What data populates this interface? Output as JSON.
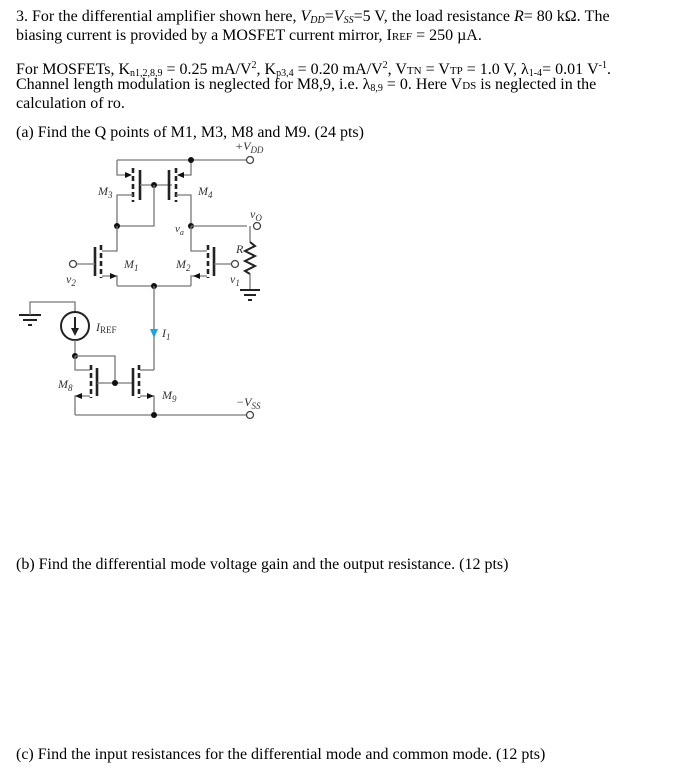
{
  "problem": {
    "number": "3.",
    "intro_1a": "For the differential amplifier shown here, ",
    "vdd_sym": "V",
    "vdd_sub": "DD",
    "eq1": "=",
    "vss_sym": "V",
    "vss_sub": "SS",
    "intro_1b": "=5 V, the load resistance ",
    "r_sym": "R",
    "intro_1c": "= 80 kΩ.  The",
    "intro_2a": "biasing current is provided by a MOSFET current mirror, I",
    "iref_sub": "REF",
    "intro_2b": " = 250 µA.",
    "params_1a": "For MOSFETs, K",
    "kn_sub": "n1,2,8,9",
    "params_1b": " = 0.25 mA/V",
    "sq": "2",
    "params_1c": ", K",
    "kp_sub": "p3,4",
    "params_1d": " = 0.20 mA/V",
    "params_1e": ", V",
    "vtn_sub": "TN",
    "params_1f": " = V",
    "vtp_sub": "TP",
    "params_1g": " = 1.0 V, λ",
    "lambda_sub": "1-4",
    "params_1h": "= 0.01 V",
    "inv": "-1",
    "params_1i": ".",
    "params_2a": "Channel length modulation is neglected for M8,9, i.e. λ",
    "lambda89_sub": "8,9",
    "params_2b": " = 0. Here V",
    "vds_sub": "DS",
    "params_2c": " is neglected in the",
    "params_3": "calculation of ro.",
    "part_a": "(a) Find the Q points of M1, M3, M8 and M9. (24 pts)",
    "part_b": "(b) Find the differential mode voltage gain and the output resistance. (12 pts)",
    "part_c": "(c) Find the input resistances for the differential mode and common mode.  (12 pts)"
  },
  "circuit": {
    "vdd_label": "+V",
    "vdd_sub": "DD",
    "vss_label": "−V",
    "vss_sub": "SS",
    "m1": "M",
    "m1_sub": "1",
    "m2": "M",
    "m2_sub": "2",
    "m3": "M",
    "m3_sub": "3",
    "m4": "M",
    "m4_sub": "4",
    "m8": "M",
    "m8_sub": "8",
    "m9": "M",
    "m9_sub": "9",
    "vo": "v",
    "vo_sub": "O",
    "va": "v",
    "va_sub": "a",
    "v1": "v",
    "v1_sub": "1",
    "v2": "v",
    "v2_sub": "2",
    "r": "R",
    "iref": "I",
    "iref_sub": "REF",
    "i1": "I",
    "i1_sub": "1",
    "current_arrow_color": "#1fa3e0"
  }
}
